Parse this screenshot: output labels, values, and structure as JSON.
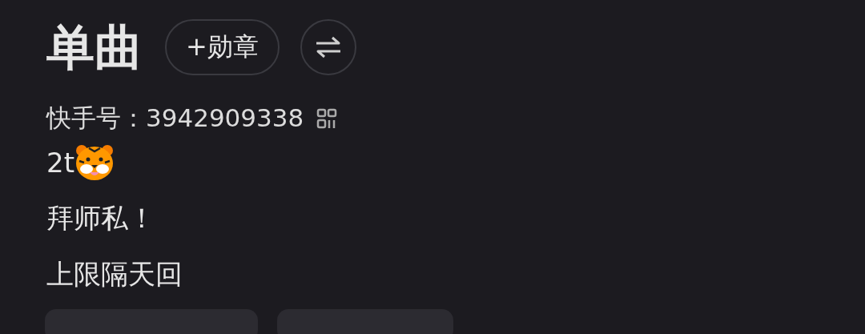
{
  "profile": {
    "name": "单曲",
    "medal_button": "+勋章",
    "id_label": "快手号：",
    "id_value": "3942909338"
  },
  "bio": [
    {
      "text": "2t",
      "kind": "with_icon"
    },
    {
      "text": "拜师私！",
      "kind": "plain"
    },
    {
      "text": "上限隔天回",
      "kind": "plain"
    }
  ],
  "tags": [
    {
      "kind": "chip"
    },
    {
      "kind": "chip"
    }
  ]
}
